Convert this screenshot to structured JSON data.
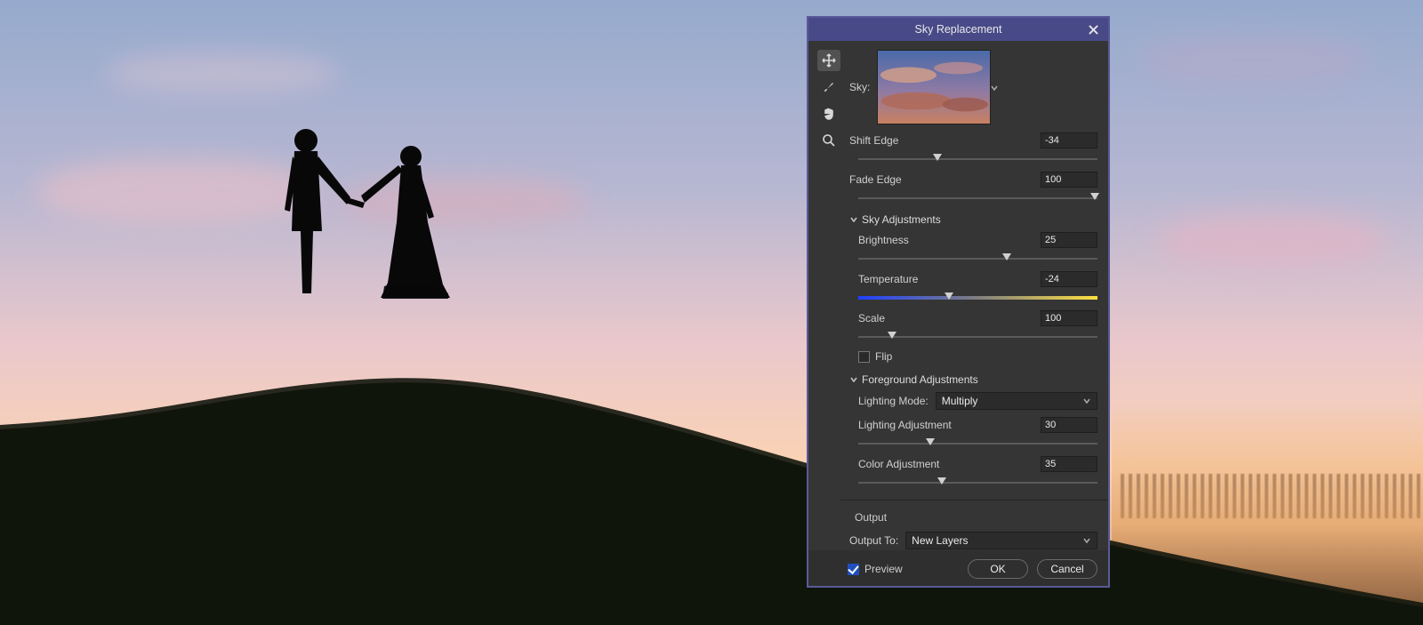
{
  "dialog": {
    "title": "Sky Replacement",
    "skyLabel": "Sky:",
    "shiftEdge": {
      "label": "Shift Edge",
      "value": "-34"
    },
    "fadeEdge": {
      "label": "Fade Edge",
      "value": "100"
    },
    "sections": {
      "sky": "Sky Adjustments",
      "fg": "Foreground Adjustments"
    },
    "brightness": {
      "label": "Brightness",
      "value": "25"
    },
    "temperature": {
      "label": "Temperature",
      "value": "-24"
    },
    "scale": {
      "label": "Scale",
      "value": "100"
    },
    "flip": {
      "label": "Flip",
      "checked": false
    },
    "lightingMode": {
      "label": "Lighting Mode:",
      "value": "Multiply"
    },
    "lightingAdj": {
      "label": "Lighting Adjustment",
      "value": "30"
    },
    "colorAdj": {
      "label": "Color Adjustment",
      "value": "35"
    },
    "output": {
      "heading": "Output",
      "toLabel": "Output To:",
      "value": "New Layers"
    },
    "preview": {
      "label": "Preview",
      "checked": true
    },
    "buttons": {
      "ok": "OK",
      "cancel": "Cancel"
    }
  },
  "sliders": {
    "shiftEdge": 33,
    "fadeEdge": 99,
    "brightness": 62,
    "temperature": 38,
    "scale": 14,
    "lightingAdj": 30,
    "colorAdj": 35
  }
}
